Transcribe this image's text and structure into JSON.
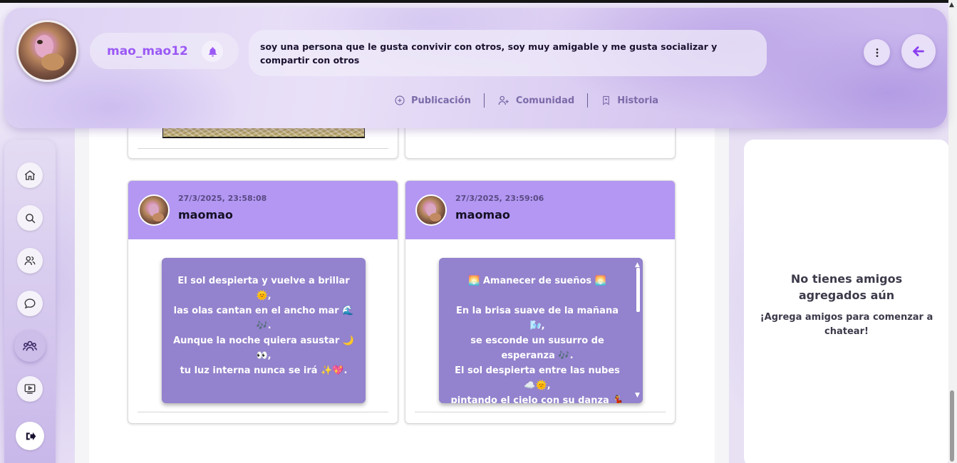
{
  "profile": {
    "username": "mao_mao12",
    "bio": "soy una persona que le gusta convivir con otros, soy muy amigable y me gusta socializar y compartir con otros"
  },
  "header_nav": [
    {
      "label": "Publicación",
      "icon": "plus-circle-icon"
    },
    {
      "label": "Comunidad",
      "icon": "add-user-icon"
    },
    {
      "label": "Historia",
      "icon": "bookmark-icon"
    }
  ],
  "sidebar": [
    {
      "name": "home",
      "icon": "home-icon"
    },
    {
      "name": "search",
      "icon": "search-icon"
    },
    {
      "name": "users",
      "icon": "users-icon"
    },
    {
      "name": "chat",
      "icon": "chat-bubble-icon"
    },
    {
      "name": "community",
      "icon": "group-icon",
      "active": true
    },
    {
      "name": "videos",
      "icon": "video-icon"
    },
    {
      "name": "logout",
      "icon": "logout-icon"
    }
  ],
  "posts": [
    {
      "date": "27/3/2025, 23:58:08",
      "user": "maomao",
      "lines": [
        "El sol despierta y vuelve a brillar 🌞,",
        "las olas cantan en el ancho mar 🌊",
        "🎶.",
        "Aunque la noche quiera asustar 🌙",
        "👀,",
        "tu luz interna nunca se irá ✨💖."
      ]
    },
    {
      "date": "27/3/2025, 23:59:06",
      "user": "maomao",
      "lines": [
        "🌅 Amanecer de sueños 🌅",
        "",
        "En la brisa suave de la mañana 🌬️,",
        "se esconde un susurro de",
        "esperanza 🎶.",
        "El sol despierta entre las nubes",
        "☁️🌞,",
        "pintando el cielo con su danza 💃",
        "✨."
      ]
    }
  ],
  "chat": {
    "empty_title": "No tienes amigos agregados aún",
    "empty_subtitle": "¡Agrega amigos para comenzar a chatear!"
  },
  "colors": {
    "accent": "#9b59f5",
    "post_header": "#b397f3",
    "poem_bg": "#9382cd"
  }
}
